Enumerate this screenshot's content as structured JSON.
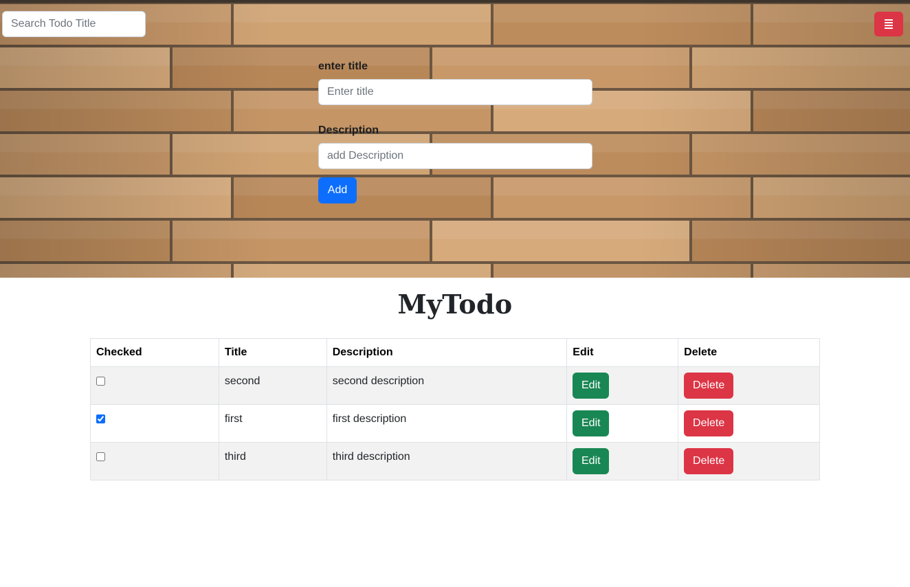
{
  "search": {
    "placeholder": "Search Todo Title"
  },
  "menu_button": {
    "icon": "menu-icon"
  },
  "form": {
    "title_label": "enter title",
    "title_placeholder": "Enter title",
    "description_label": "Description",
    "description_placeholder": "add Description",
    "add_label": "Add"
  },
  "page_title": "MyTodo",
  "table": {
    "headers": [
      "Checked",
      "Title",
      "Description",
      "Edit",
      "Delete"
    ],
    "rows": [
      {
        "checked": false,
        "title": "second",
        "description": "second description",
        "edit_label": "Edit",
        "delete_label": "Delete"
      },
      {
        "checked": true,
        "title": "first",
        "description": "first description",
        "edit_label": "Edit",
        "delete_label": "Delete"
      },
      {
        "checked": false,
        "title": "third",
        "description": "third description",
        "edit_label": "Edit",
        "delete_label": "Delete"
      }
    ]
  },
  "colors": {
    "primary": "#0d6efd",
    "success": "#198754",
    "danger": "#dc3545",
    "brick": "#c99a6b",
    "mortar": "#5a4a3a",
    "row_stripe": "#f2f2f2"
  }
}
